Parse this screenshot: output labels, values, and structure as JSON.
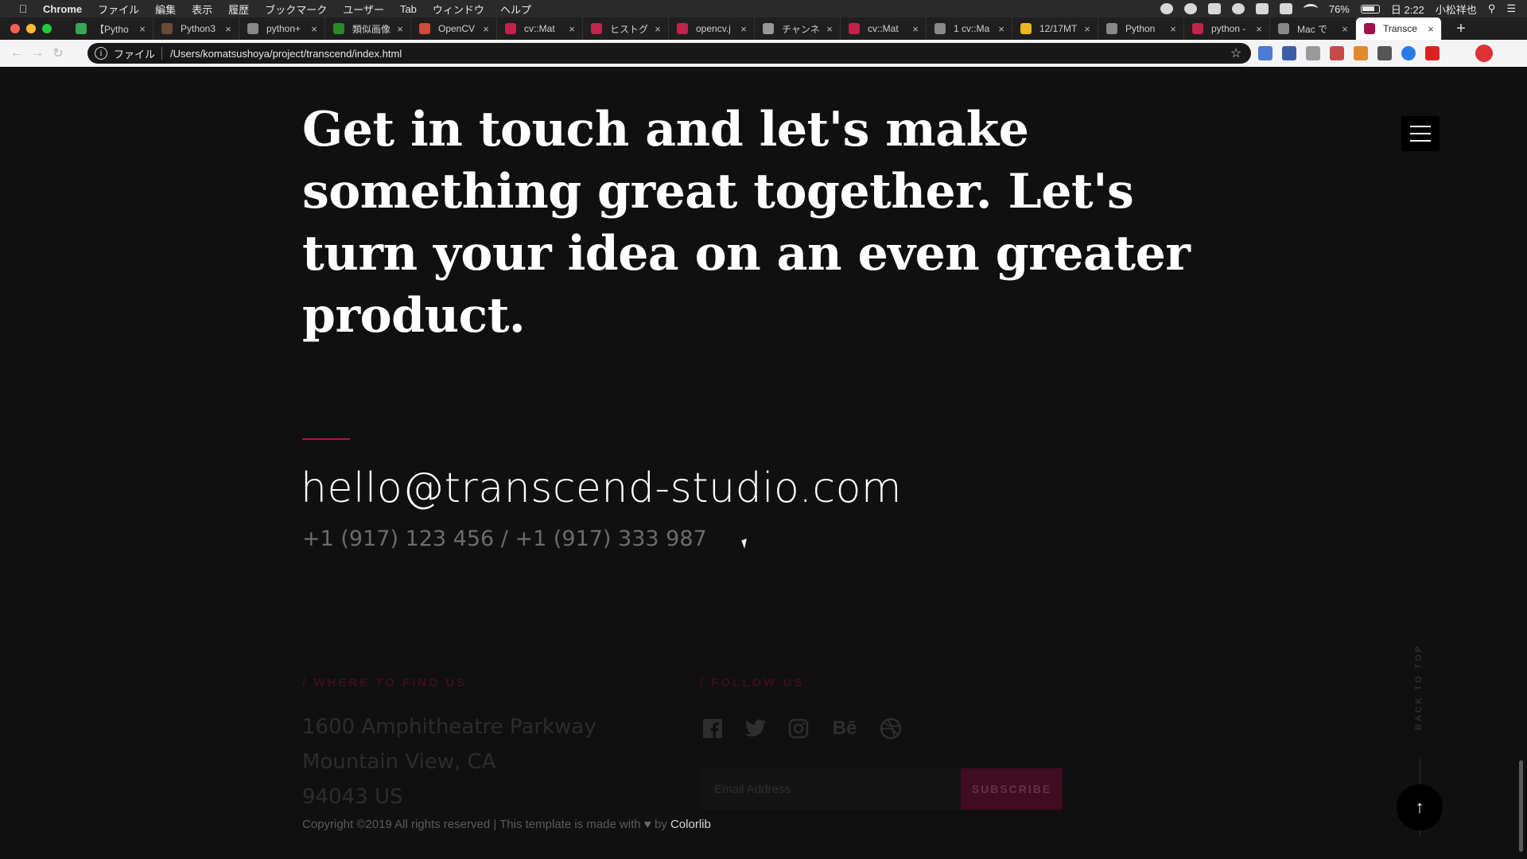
{
  "menubar": {
    "apple": "",
    "app": "Chrome",
    "items": [
      "ファイル",
      "編集",
      "表示",
      "履歴",
      "ブックマーク",
      "ユーザー",
      "Tab",
      "ウィンドウ",
      "ヘルプ"
    ],
    "battery": "76%",
    "clock": "日 2:22",
    "user": "小松祥也"
  },
  "tabs": [
    {
      "title": "【Pytho",
      "color": "#3aa55a"
    },
    {
      "title": "Python3",
      "color": "#6b4a3a"
    },
    {
      "title": "python+",
      "color": "#888888"
    },
    {
      "title": "類似画像",
      "color": "#2a8a2a"
    },
    {
      "title": "OpenCV",
      "color": "#d04a3a"
    },
    {
      "title": "cv::Mat",
      "color": "#c0244a"
    },
    {
      "title": "ヒストグ",
      "color": "#c0244a"
    },
    {
      "title": "opencv.j",
      "color": "#c0244a"
    },
    {
      "title": "チャンネ",
      "color": "#999999"
    },
    {
      "title": "cv::Mat",
      "color": "#c0244a"
    },
    {
      "title": "1 cv::Ma",
      "color": "#888888"
    },
    {
      "title": "12/17MT",
      "color": "#e8b81c"
    },
    {
      "title": "Python",
      "color": "#888888"
    },
    {
      "title": "python -",
      "color": "#c0244a"
    },
    {
      "title": "Mac で",
      "color": "#888888"
    },
    {
      "title": "Transce",
      "color": "#a0124a",
      "active": true
    }
  ],
  "toolbar": {
    "scheme": "ファイル",
    "url": "/Users/komatsushoya/project/transcend/index.html"
  },
  "page": {
    "headline": "Get in touch and let's make something great together. Let's turn your idea on an even greater product.",
    "email": "hello@transcend-studio.com",
    "phones": "+1 (917) 123 456 / +1 (917) 333 987",
    "find_label": "/ WHERE TO FIND US",
    "address": [
      "1600 Amphitheatre Parkway",
      "Mountain View, CA",
      "94043 US"
    ],
    "follow_label": "/ FOLLOW US",
    "subscribe_placeholder": "Email Address",
    "subscribe_button": "SUBSCRIBE",
    "copyright_prefix": "Copyright ©2019 All rights reserved | This template is made with",
    "copyright_by": "by",
    "copyright_brand": "Colorlib",
    "back_to_top": "BACK TO TOP",
    "accent_color": "#b0134d"
  }
}
